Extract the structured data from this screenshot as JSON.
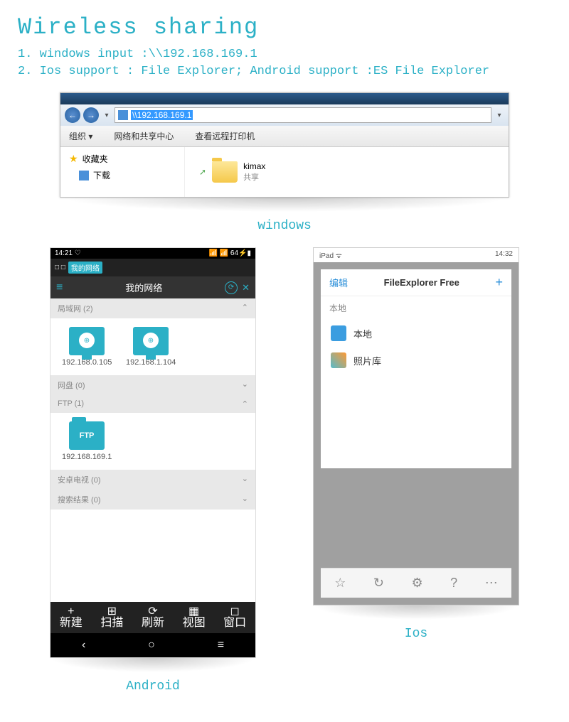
{
  "header": {
    "title": "Wireless sharing",
    "line1": "1. windows input :\\\\192.168.169.1",
    "line2": "2. Ios support : File Explorer; Android support :ES File Explorer"
  },
  "windows": {
    "caption": "windows",
    "address": "\\\\192.168.169.1",
    "toolbar": {
      "org": "组织 ▾",
      "center": "网络和共享中心",
      "printer": "查看远程打印机"
    },
    "sidebar": {
      "fav": "收藏夹",
      "dl": "下载"
    },
    "folder": {
      "name": "kimax",
      "sub": "共享"
    }
  },
  "android": {
    "caption": "Android",
    "status": {
      "time": "14:21 ♡",
      "bat": "📶 📶 64⚡▮"
    },
    "urlbar": {
      "tabs": "□ □",
      "chip": "我的网络"
    },
    "header": {
      "title": "我的网络"
    },
    "sections": {
      "lan": "局域网 (2)",
      "ftp": "FTP (1)",
      "tv": "安卓电视 (0)",
      "search": "搜索结果 (0)"
    },
    "devices": {
      "d1": "192.168.0.105",
      "d2": "192.168.1.104",
      "ftp": "192.168.169.1",
      "ftp_label": "FTP"
    },
    "bottom": {
      "new": "新建",
      "scan": "扫描",
      "refresh": "刷新",
      "view": "视图",
      "window": "窗口"
    }
  },
  "ios": {
    "caption": "Ios",
    "status": {
      "dev": "iPad ᯤ",
      "time": "14:32"
    },
    "hdr": {
      "edit": "编辑",
      "title": "FileExplorer Free",
      "add": "+"
    },
    "section": "本地",
    "rows": {
      "r1": "本地",
      "r2": "照片库"
    }
  }
}
